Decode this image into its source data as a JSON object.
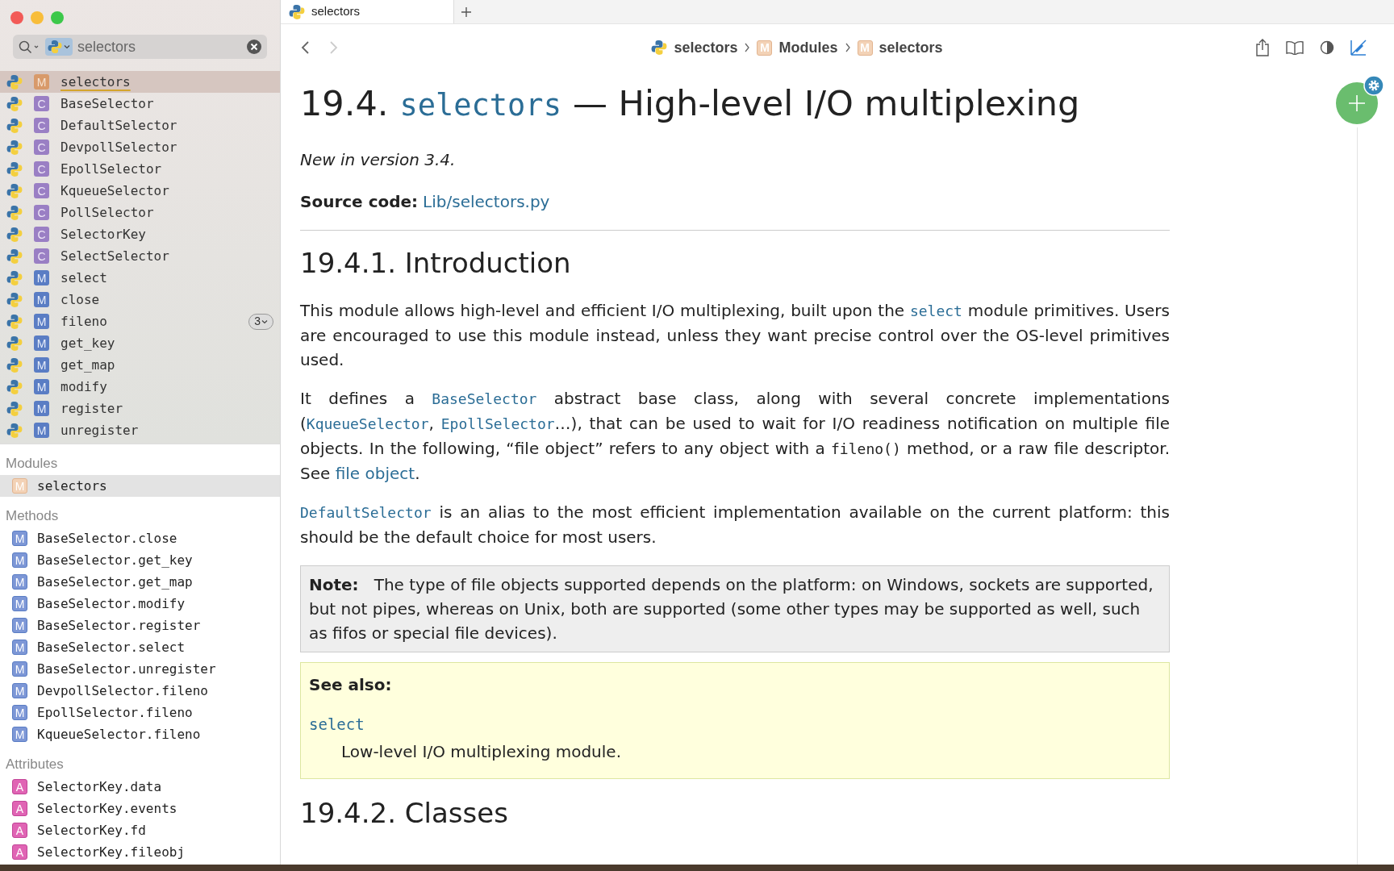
{
  "tabs": [
    {
      "label": "selectors",
      "selected": true
    }
  ],
  "search": {
    "value": "selectors"
  },
  "results": [
    {
      "kind": "module",
      "letter": "M",
      "label": "selectors",
      "selected": true
    },
    {
      "kind": "class",
      "letter": "C",
      "label": "BaseSelector",
      "selected": false
    },
    {
      "kind": "class",
      "letter": "C",
      "label": "DefaultSelector",
      "selected": false
    },
    {
      "kind": "class",
      "letter": "C",
      "label": "DevpollSelector",
      "selected": false
    },
    {
      "kind": "class",
      "letter": "C",
      "label": "EpollSelector",
      "selected": false
    },
    {
      "kind": "class",
      "letter": "C",
      "label": "KqueueSelector",
      "selected": false
    },
    {
      "kind": "class",
      "letter": "C",
      "label": "PollSelector",
      "selected": false
    },
    {
      "kind": "class",
      "letter": "C",
      "label": "SelectorKey",
      "selected": false
    },
    {
      "kind": "class",
      "letter": "C",
      "label": "SelectSelector",
      "selected": false
    },
    {
      "kind": "method",
      "letter": "M",
      "label": "select",
      "selected": false
    },
    {
      "kind": "method",
      "letter": "M",
      "label": "close",
      "selected": false
    },
    {
      "kind": "method",
      "letter": "M",
      "label": "fileno",
      "selected": false,
      "count": "3"
    },
    {
      "kind": "method",
      "letter": "M",
      "label": "get_key",
      "selected": false
    },
    {
      "kind": "method",
      "letter": "M",
      "label": "get_map",
      "selected": false
    },
    {
      "kind": "method",
      "letter": "M",
      "label": "modify",
      "selected": false
    },
    {
      "kind": "method",
      "letter": "M",
      "label": "register",
      "selected": false
    },
    {
      "kind": "method",
      "letter": "M",
      "label": "unregister",
      "selected": false
    }
  ],
  "sections": [
    {
      "title": "Modules",
      "items": [
        {
          "kind": "module",
          "letter": "M",
          "label": "selectors",
          "selected": true
        }
      ]
    },
    {
      "title": "Methods",
      "items": [
        {
          "kind": "method",
          "letter": "M",
          "label": "BaseSelector.close",
          "selected": false
        },
        {
          "kind": "method",
          "letter": "M",
          "label": "BaseSelector.get_key",
          "selected": false
        },
        {
          "kind": "method",
          "letter": "M",
          "label": "BaseSelector.get_map",
          "selected": false
        },
        {
          "kind": "method",
          "letter": "M",
          "label": "BaseSelector.modify",
          "selected": false
        },
        {
          "kind": "method",
          "letter": "M",
          "label": "BaseSelector.register",
          "selected": false
        },
        {
          "kind": "method",
          "letter": "M",
          "label": "BaseSelector.select",
          "selected": false
        },
        {
          "kind": "method",
          "letter": "M",
          "label": "BaseSelector.unregister",
          "selected": false
        },
        {
          "kind": "method",
          "letter": "M",
          "label": "DevpollSelector.fileno",
          "selected": false
        },
        {
          "kind": "method",
          "letter": "M",
          "label": "EpollSelector.fileno",
          "selected": false
        },
        {
          "kind": "method",
          "letter": "M",
          "label": "KqueueSelector.fileno",
          "selected": false
        }
      ]
    },
    {
      "title": "Attributes",
      "items": [
        {
          "kind": "attribute",
          "letter": "A",
          "label": "SelectorKey.data",
          "selected": false
        },
        {
          "kind": "attribute",
          "letter": "A",
          "label": "SelectorKey.events",
          "selected": false
        },
        {
          "kind": "attribute",
          "letter": "A",
          "label": "SelectorKey.fd",
          "selected": false
        },
        {
          "kind": "attribute",
          "letter": "A",
          "label": "SelectorKey.fileobj",
          "selected": false
        }
      ]
    }
  ],
  "breadcrumb": [
    {
      "kind": "docset",
      "label": "selectors"
    },
    {
      "kind": "module",
      "letter": "M",
      "label": "Modules"
    },
    {
      "kind": "module",
      "letter": "M",
      "label": "selectors"
    }
  ],
  "page": {
    "title": {
      "number": "19.4.",
      "module": "selectors",
      "rest": "— High-level I/O multiplexing"
    },
    "version_note": "New in version 3.4.",
    "source": {
      "label": "Source code:",
      "link": "Lib/selectors.py"
    },
    "intro_heading": "19.4.1. Introduction",
    "paragraphs": [
      [
        {
          "kind": "text",
          "text": "This module allows high-level and efficient I/O multiplexing, built upon the "
        },
        {
          "kind": "code_link",
          "text": "select"
        },
        {
          "kind": "text",
          "text": " module primitives. Users are encouraged to use this module instead, unless they want precise control over the OS-level primitives used."
        }
      ],
      [
        {
          "kind": "text",
          "text": "It defines a "
        },
        {
          "kind": "code_link",
          "text": "BaseSelector"
        },
        {
          "kind": "text",
          "text": " abstract base class, along with several concrete implementations ("
        },
        {
          "kind": "code_link",
          "text": "KqueueSelector"
        },
        {
          "kind": "text",
          "text": ", "
        },
        {
          "kind": "code_link",
          "text": "EpollSelector"
        },
        {
          "kind": "text",
          "text": "…), that can be used to wait for I/O readiness notification on multiple file objects. In the following, “file object” refers to any object with a "
        },
        {
          "kind": "code",
          "text": "fileno()"
        },
        {
          "kind": "text",
          "text": " method, or a raw file descriptor. See "
        },
        {
          "kind": "link",
          "text": "file object"
        },
        {
          "kind": "text",
          "text": "."
        }
      ],
      [
        {
          "kind": "code_link",
          "text": "DefaultSelector"
        },
        {
          "kind": "text",
          "text": " is an alias to the most efficient implementation available on the current platform: this should be the default choice for most users."
        }
      ]
    ],
    "note": {
      "label": "Note:",
      "text": "The type of file objects supported depends on the platform: on Windows, sockets are supported, but not pipes, whereas on Unix, both are supported (some other types may be supported as well, such as fifos or special file devices)."
    },
    "see_also": {
      "label": "See also:",
      "link": "select",
      "description": "Low-level I/O multiplexing module."
    },
    "classes_heading": "19.4.2. Classes"
  }
}
